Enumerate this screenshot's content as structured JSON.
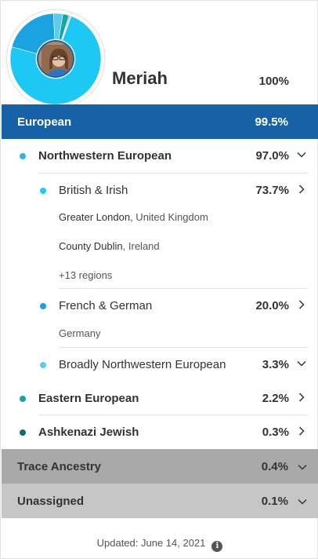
{
  "profile": {
    "name": "Meriah",
    "total": "100%"
  },
  "european": {
    "label": "European",
    "percent": "99.5%"
  },
  "rows": {
    "nw_european": {
      "label": "Northwestern European",
      "percent": "97.0%"
    },
    "british_irish": {
      "label": "British & Irish",
      "percent": "73.7%"
    },
    "french_german": {
      "label": "French & German",
      "percent": "20.0%"
    },
    "broadly_nw": {
      "label": "Broadly Northwestern European",
      "percent": "3.3%"
    },
    "eastern": {
      "label": "Eastern European",
      "percent": "2.2%"
    },
    "ashkenazi": {
      "label": "Ashkenazi Jewish",
      "percent": "0.3%"
    }
  },
  "regions": {
    "british_irish": [
      {
        "place": "Greater London",
        "country": ", United Kingdom"
      },
      {
        "place": "County Dublin",
        "country": ", Ireland"
      },
      {
        "place": "+13 regions",
        "country": ""
      }
    ],
    "french_german": [
      {
        "place": "Germany",
        "country": ""
      }
    ]
  },
  "trace": {
    "label": "Trace Ancestry",
    "percent": "0.4%"
  },
  "unassigned": {
    "label": "Unassigned",
    "percent": "0.1%"
  },
  "footer": {
    "updated": "Updated: June 14, 2021",
    "info_icon": "i"
  },
  "colors": {
    "european_band": "#1762a6",
    "dot_nw": "#29b6e8",
    "dot_british": "#1ec8f5",
    "dot_french": "#1aa3e0",
    "dot_broadly": "#5fc9ef",
    "dot_eastern": "#14a6a6",
    "dot_ashkenazi": "#0f6e6e"
  },
  "donut": {
    "segments": [
      {
        "name": "British & Irish",
        "value": 73.7,
        "color": "#1ec8f5"
      },
      {
        "name": "French & German",
        "value": 20.0,
        "color": "#1aa3e0"
      },
      {
        "name": "Broadly Northwestern European",
        "value": 3.3,
        "color": "#5fc9ef"
      },
      {
        "name": "Eastern European",
        "value": 2.2,
        "color": "#14a6a6"
      },
      {
        "name": "Ashkenazi Jewish",
        "value": 0.3,
        "color": "#0f6e6e"
      },
      {
        "name": "Trace Ancestry",
        "value": 0.4,
        "color": "#a9a9a9"
      },
      {
        "name": "Unassigned",
        "value": 0.1,
        "color": "#c6c6c6"
      }
    ]
  }
}
